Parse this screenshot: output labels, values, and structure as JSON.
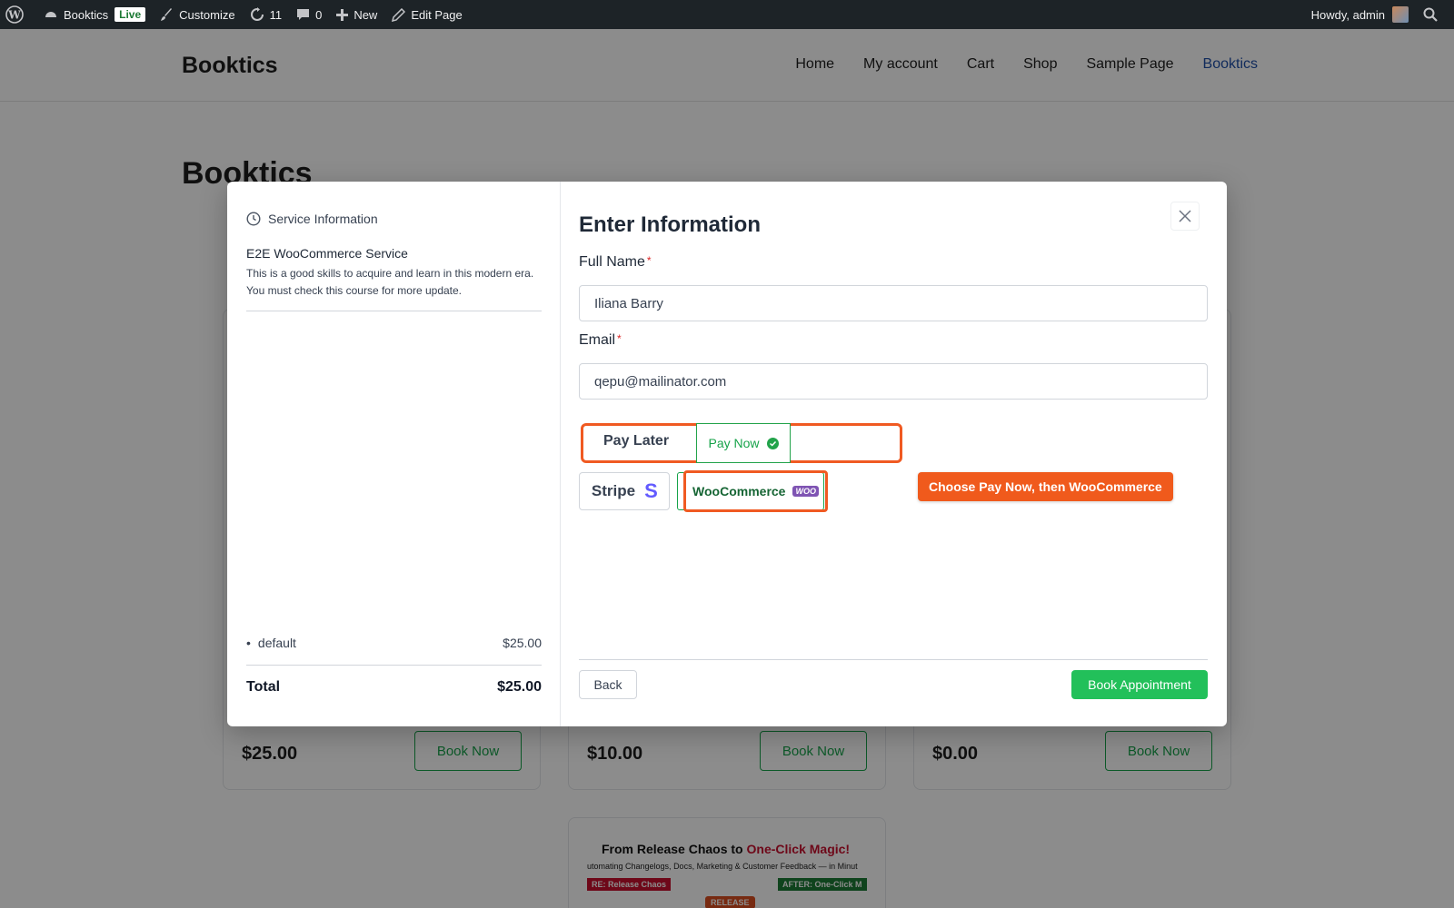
{
  "adminbar": {
    "site_name": "Booktics",
    "live_badge": "Live",
    "customize": "Customize",
    "updates_count": "11",
    "comments_count": "0",
    "new_label": "New",
    "edit_page": "Edit Page",
    "howdy": "Howdy, admin"
  },
  "site": {
    "title": "Booktics",
    "nav": [
      "Home",
      "My account",
      "Cart",
      "Shop",
      "Sample Page",
      "Booktics"
    ],
    "page_heading": "Booktics"
  },
  "cards": [
    {
      "price": "$25.00",
      "button": "Book Now"
    },
    {
      "price": "$10.00",
      "button": "Book Now"
    },
    {
      "price": "$0.00",
      "button": "Book Now"
    }
  ],
  "promo": {
    "title_a": "From Release Chaos to ",
    "title_b": "One-Click Magic!",
    "subtitle": "utomating Changelogs, Docs, Marketing & Customer Feedback — in Minut",
    "tag_left": "RE: Release Chaos",
    "tag_right": "AFTER: One-Click M",
    "release": "RELEASE"
  },
  "modal": {
    "left": {
      "service_info_heading": "Service Information",
      "service_name": "E2E WooCommerce Service",
      "service_desc": "This is a good skills to acquire and learn in this modern era. You must check this course for more update.",
      "line_item_name": "default",
      "line_item_price": "$25.00",
      "total_label": "Total",
      "total_value": "$25.00"
    },
    "right": {
      "title": "Enter Information",
      "full_name_label": "Full Name",
      "full_name_value": "Iliana Barry",
      "email_label": "Email",
      "email_value": "qepu@mailinator.com",
      "required_mark": "*",
      "pay_later": "Pay Later",
      "pay_now": "Pay Now",
      "gateway_stripe": "Stripe",
      "gateway_woocommerce": "WooCommerce",
      "woo_badge": "WOO",
      "hint": "Choose Pay Now, then WooCommerce",
      "back": "Back",
      "book_appointment": "Book Appointment"
    }
  },
  "colors": {
    "accent_green": "#22c05a",
    "highlight_orange": "#f05a22",
    "admin_bar": "#1d2327",
    "nav_active": "#1f4fa8"
  }
}
